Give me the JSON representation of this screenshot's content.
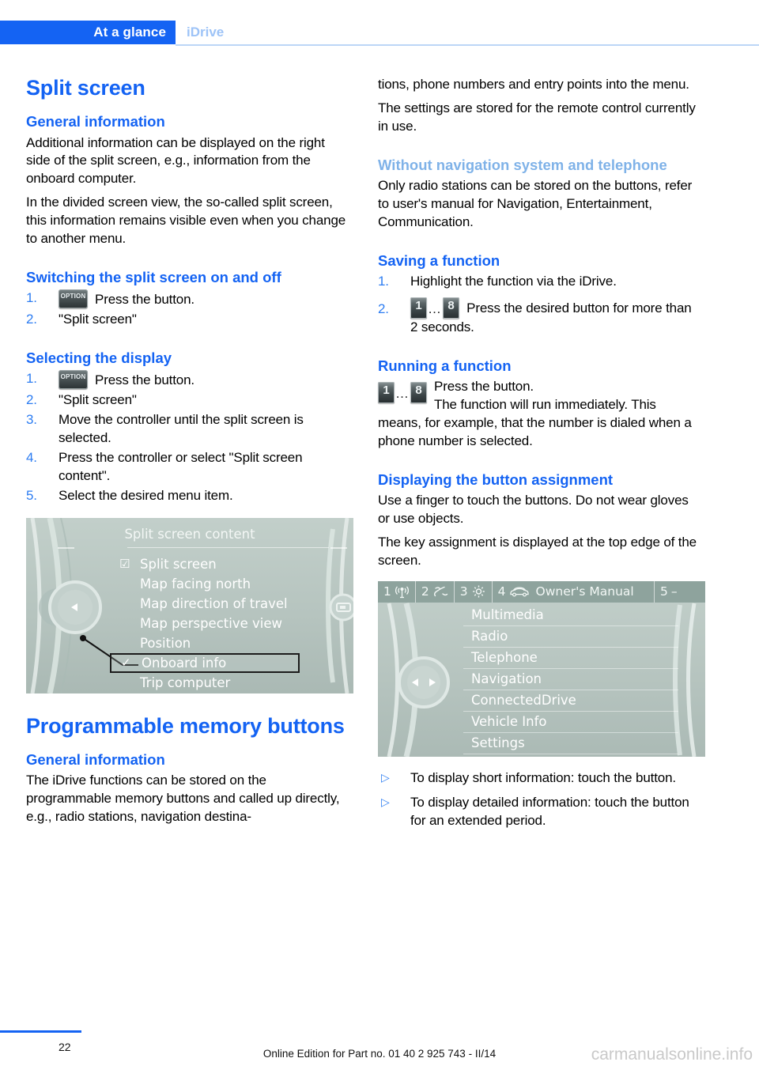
{
  "header": {
    "primary_tab": "At a glance",
    "secondary_tab": "iDrive"
  },
  "left_column": {
    "title": "Split screen",
    "general_heading": "General information",
    "general_p1": "Additional information can be displayed on the right side of the split screen, e.g., information from the onboard computer.",
    "general_p2": "In the divided screen view, the so-called split screen, this information remains visible even when you change to another menu.",
    "switching_heading": "Switching the split screen on and off",
    "switching_steps": [
      {
        "num": "1.",
        "icon": "OPTION",
        "text": "Press the button."
      },
      {
        "num": "2.",
        "text": "\"Split screen\""
      }
    ],
    "selecting_heading": "Selecting the display",
    "selecting_steps": [
      {
        "num": "1.",
        "icon": "OPTION",
        "text": "Press the button."
      },
      {
        "num": "2.",
        "text": "\"Split screen\""
      },
      {
        "num": "3.",
        "text": "Move the controller until the split screen is selected."
      },
      {
        "num": "4.",
        "text": "Press the controller or select \"Split screen content\"."
      },
      {
        "num": "5.",
        "text": "Select the desired menu item."
      }
    ],
    "memory_title": "Programmable memory buttons",
    "memory_general_heading": "General information",
    "memory_general_p1": "The iDrive functions can be stored on the programmable memory buttons and called up directly, e.g., radio stations, navigation destina-"
  },
  "idrive_screen_1": {
    "title": "Split screen content",
    "items": [
      {
        "label": "Split screen",
        "mark": "checkbox",
        "selected": false
      },
      {
        "label": "Map facing north",
        "mark": "none",
        "selected": false
      },
      {
        "label": "Map direction of travel",
        "mark": "none",
        "selected": false
      },
      {
        "label": "Map perspective view",
        "mark": "none",
        "selected": false
      },
      {
        "label": "Position",
        "mark": "none",
        "selected": false
      },
      {
        "label": "Onboard info",
        "mark": "check",
        "selected": true
      },
      {
        "label": "Trip computer",
        "mark": "none",
        "selected": false
      }
    ]
  },
  "right_column": {
    "cont_p1": "tions, phone numbers and entry points into the menu.",
    "cont_p2": "The settings are stored for the remote control currently in use.",
    "without_nav_heading": "Without navigation system and telephone",
    "without_nav_p1": "Only radio stations can be stored on the buttons, refer to user's manual for Navigation, Entertainment, Communication.",
    "saving_heading": "Saving a function",
    "saving_steps": [
      {
        "num": "1.",
        "text": "Highlight the function via the iDrive."
      },
      {
        "num": "2.",
        "icon": "1...8",
        "text": "Press the desired button for more than 2 seconds."
      }
    ],
    "running_heading": "Running a function",
    "running_line1": "Press the button.",
    "running_line2": "The function will run immediately. This means, for example, that the number is dialed when a phone number is selected.",
    "displaying_heading": "Displaying the button assignment",
    "displaying_p1": "Use a finger to touch the buttons. Do not wear gloves or use objects.",
    "displaying_p2": "The key assignment is displayed at the top edge of the screen.",
    "bullets": [
      "To display short information: touch the button.",
      "To display detailed information: touch the button for an extended period."
    ]
  },
  "idrive_screen_2": {
    "topbar": [
      {
        "num": "1",
        "icon": "radio-antenna-icon"
      },
      {
        "num": "2",
        "icon": "phone-handset-icon"
      },
      {
        "num": "3",
        "icon": "gear-icon"
      },
      {
        "num": "4",
        "icon": "car-icon",
        "label": "Owner's Manual"
      },
      {
        "num": "5",
        "icon": "dash-icon"
      }
    ],
    "topbar_label": "Owner's Manual",
    "topbar_num1": "1",
    "topbar_num2": "2",
    "topbar_num3": "3",
    "topbar_num4": "4",
    "topbar_num5": "5",
    "topbar_dash": "–",
    "rows": [
      "Multimedia",
      "Radio",
      "Telephone",
      "Navigation",
      "ConnectedDrive",
      "Vehicle Info",
      "Settings"
    ]
  },
  "button_glyphs": {
    "option_label": "OPTION",
    "mem_first": "1",
    "mem_last": "8",
    "mem_dots": "…"
  },
  "footer": {
    "page_number": "22",
    "edition": "Online Edition for Part no. 01 40 2 925 743 - II/14",
    "watermark": "carmanualsonline.info"
  },
  "colors": {
    "accent_blue": "#1463f3",
    "light_blue": "#7fb2e8",
    "tab_inactive": "#9dc3f7",
    "idrive_bg": "#b9c7c3"
  }
}
